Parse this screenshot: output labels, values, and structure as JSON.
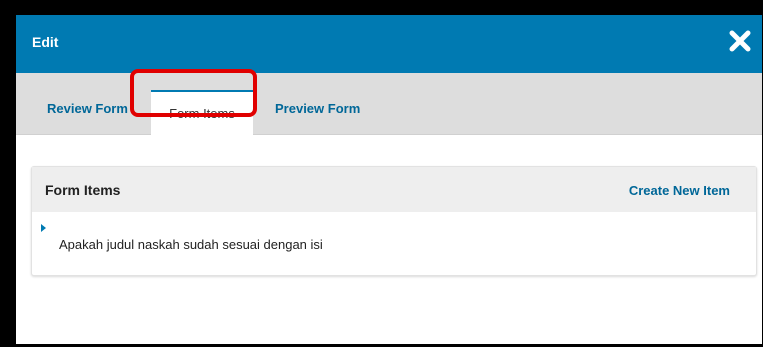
{
  "modal": {
    "title": "Edit",
    "close_icon": "close-icon"
  },
  "tabs": [
    {
      "label": "Review Form"
    },
    {
      "label": "Form Items",
      "active": true
    },
    {
      "label": "Preview Form"
    }
  ],
  "panel": {
    "title": "Form Items",
    "action_label": "Create New Item",
    "items": [
      {
        "text": "Apakah judul naskah sudah sesuai dengan isi"
      }
    ]
  },
  "colors": {
    "header": "#007ab2",
    "link": "#006798",
    "highlight": "#e00000"
  }
}
